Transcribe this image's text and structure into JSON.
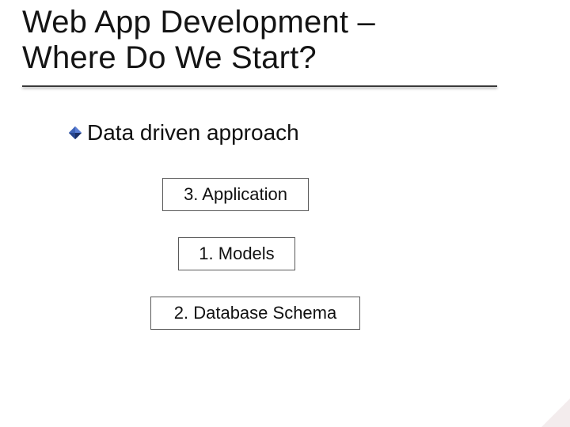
{
  "title": {
    "line1": "Web App Development –",
    "line2": "Where Do We Start?"
  },
  "bullet": {
    "text": "Data driven approach"
  },
  "boxes": {
    "application": "3. Application",
    "models": "1. Models",
    "schema": "2. Database Schema"
  }
}
